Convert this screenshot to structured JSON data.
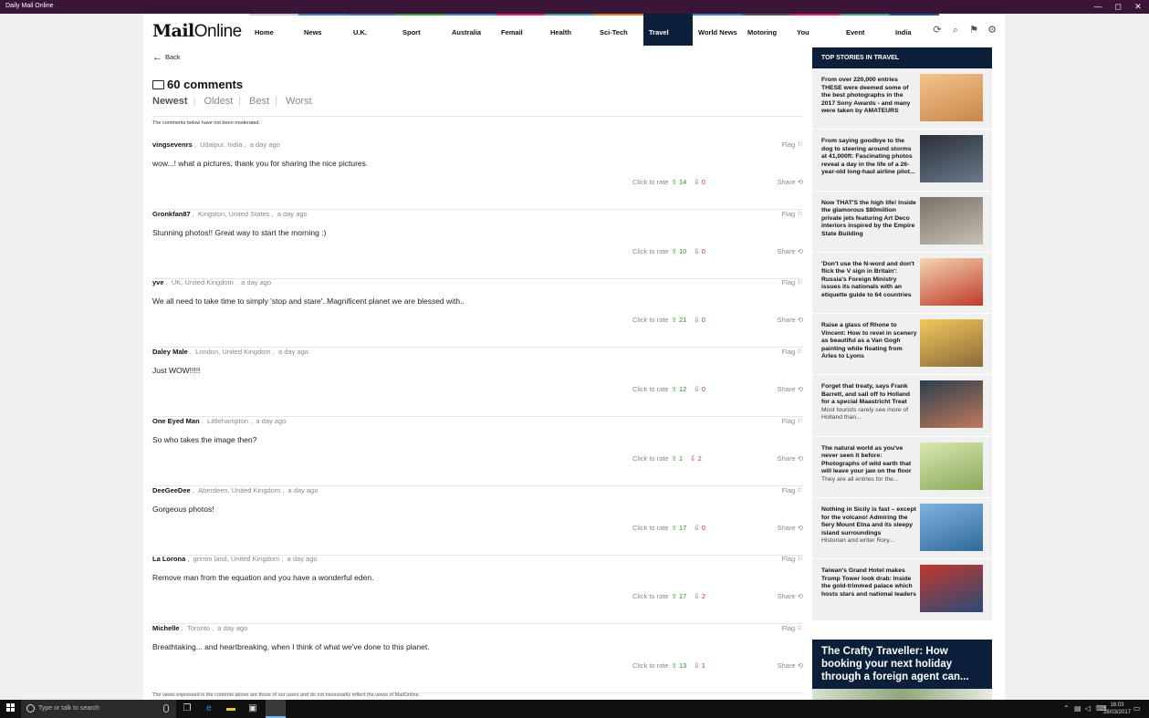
{
  "window": {
    "title": "Daily Mail Online",
    "min": "—",
    "max": "◻",
    "close": "✕"
  },
  "logo": {
    "bold": "Mail",
    "light": "Online"
  },
  "nav": [
    {
      "label": "Home",
      "color": "#cccccc"
    },
    {
      "label": "News",
      "color": "#3b82c4"
    },
    {
      "label": "U.K.",
      "color": "#4a6fb5"
    },
    {
      "label": "Sport",
      "color": "#3aa13a"
    },
    {
      "label": "Australia",
      "color": "#3b82c4"
    },
    {
      "label": "Femail",
      "color": "#d6246e"
    },
    {
      "label": "Health",
      "color": "#3aa1a1"
    },
    {
      "label": "Sci-Tech",
      "color": "#e07b22"
    },
    {
      "label": "Travel",
      "color": "#0b1f3a"
    },
    {
      "label": "World News",
      "color": "#3b82c4"
    },
    {
      "label": "Motoring",
      "color": "#555555"
    },
    {
      "label": "You",
      "color": "#d6246e"
    },
    {
      "label": "Event",
      "color": "#3aa1a1"
    },
    {
      "label": "India",
      "color": "#1f4f9a"
    }
  ],
  "back_label": "Back",
  "comments_header": "60 comments",
  "sort_options": [
    "Newest",
    "Oldest",
    "Best",
    "Worst"
  ],
  "moderation_notice": "The comments below have not been moderated.",
  "labels": {
    "flag": "Flag",
    "click_to_rate": "Click to rate",
    "share": "Share"
  },
  "comments": [
    {
      "user": "vingsevenrs",
      "location": "Udaipur, India",
      "time": "a day ago",
      "text": "wow...! what a pictures, thank you for sharing the nice pictures.",
      "up": "14",
      "down": "0"
    },
    {
      "user": "Gronkfan87",
      "location": "Kingston, United States",
      "time": "a day ago",
      "text": "Stunning photos!! Great way to start the morning :)",
      "up": "10",
      "down": "0"
    },
    {
      "user": "yve",
      "location": "UK, United Kingdom",
      "time": "a day ago",
      "text": "We all need to take time to simply 'stop and stare'..Magnificent planet we are blessed with..",
      "up": "21",
      "down": "0"
    },
    {
      "user": "Daley Male",
      "location": "London, United Kingdom",
      "time": "a day ago",
      "text": "Just WOW!!!!!",
      "up": "12",
      "down": "0"
    },
    {
      "user": "One Eyed Man",
      "location": "Littlehampton",
      "time": "a day ago",
      "text": "So who takes the image then?",
      "up": "1",
      "down": "2"
    },
    {
      "user": "DeeGeeDee",
      "location": "Aberdeen, United Kingdom",
      "time": "a day ago",
      "text": "Gorgeous photos!",
      "up": "17",
      "down": "0"
    },
    {
      "user": "La Lorona",
      "location": "grimm land, United Kingdom",
      "time": "a day ago",
      "text": "Remove man from the equation and you have a wonderful eden.",
      "up": "17",
      "down": "2"
    },
    {
      "user": "Michelle",
      "location": "Toronto",
      "time": "a day ago",
      "text": "Breathtaking... and heartbreaking, when I think of what we've done to this planet.",
      "up": "13",
      "down": "1"
    }
  ],
  "footer_note": "The views expressed in the contents above are those of our users and do not necessarily reflect the views of MailOnline.",
  "sidebar": {
    "heading": "TOP STORIES IN TRAVEL",
    "stories": [
      {
        "title": "From over 220,000 entries THESE were deemed some of the best photographs in the 2017 Sony Awards - and many were taken by AMATEURS",
        "sub": "",
        "colors": [
          "#f3c48a",
          "#c9864a"
        ]
      },
      {
        "title": "From saying goodbye to the dog to steering around storms at 41,000ft: Fascinating photos reveal a day in the life of a 26-year-old long-haul airline pilot...",
        "sub": "",
        "colors": [
          "#2a2f3a",
          "#6b7a8a"
        ]
      },
      {
        "title": "Now THAT'S the high life! Inside the glamorous $80million private jets featuring Art Deco interiors inspired by the Empire State Building",
        "sub": "",
        "colors": [
          "#7a7066",
          "#c8c0b4"
        ]
      },
      {
        "title": "'Don't use the N-word and don't flick the V sign in Britain': Russia's Foreign Ministry issues its nationals with an etiquette guide to 64 countries",
        "sub": "",
        "colors": [
          "#f4d6b0",
          "#c0392b"
        ]
      },
      {
        "title": "Raise a glass of Rhone to Vincent: How to revel in scenery as beautiful as a Van Gogh painting while floating from Arles to Lyons",
        "sub": "",
        "colors": [
          "#f2c85b",
          "#8a6a3a"
        ]
      },
      {
        "title": "Forget that treaty, says Frank Barrett, and sail off to Holland for a special Maastricht Treat",
        "sub": "Most tourists rarely see more of Holland than...",
        "colors": [
          "#2c3e50",
          "#c07a5a"
        ]
      },
      {
        "title": "The natural world as you've never seen it before: Photographs of wild earth that will leave your jaw on the floor",
        "sub": "They are all entries for the...",
        "colors": [
          "#d9e8b0",
          "#8aa85a"
        ]
      },
      {
        "title": "Nothing in Sicily is fast – except for the volcano! Admiring the fiery Mount Etna and its sleepy island surroundings",
        "sub": "Historian and writer Rory...",
        "colors": [
          "#7fb3e0",
          "#2f6a9a"
        ]
      },
      {
        "title": "Taiwan's Grand Hotel makes Trump Tower look drab: Inside the gold-trimmed palace which hosts stars and national leaders",
        "sub": "",
        "colors": [
          "#c0392b",
          "#2a4a7a"
        ]
      }
    ],
    "promo": "The Crafty Traveller: How booking your next holiday through a foreign agent can..."
  },
  "taskbar": {
    "search_placeholder": "Type or talk to search",
    "time": "16:03",
    "date": "28/03/2017"
  }
}
